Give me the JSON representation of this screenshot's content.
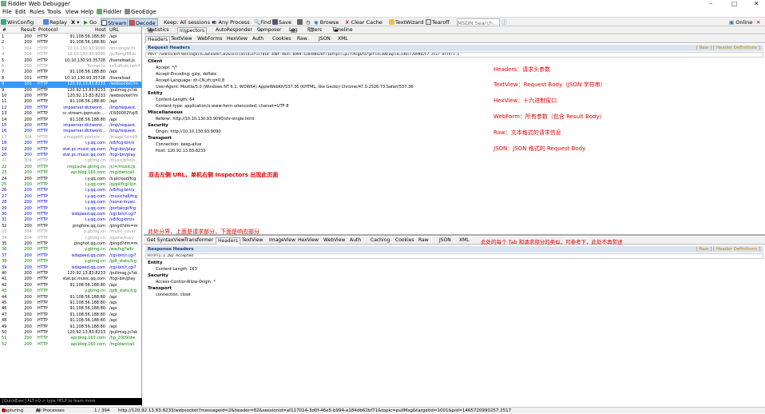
{
  "app": {
    "title": "Fiddler Web Debugger"
  },
  "menu": [
    "File",
    "Edit",
    "Rules",
    "Tools",
    "View",
    "Help",
    "Fiddler",
    "GeoEdge"
  ],
  "toolbar": {
    "winconfig": "WinConfig",
    "replay": "Replay",
    "x": "X",
    "go": "Go",
    "stream": "Stream",
    "decode": "Decode",
    "keep": "Keep: All sessions",
    "any_process": "Any Process",
    "find": "Find",
    "save": "Save",
    "browse": "Browse",
    "clear_cache": "Clear Cache",
    "textwizard": "TextWizard",
    "tearoff": "Tearoff",
    "msdn": "MSDN Search...",
    "online": "Online"
  },
  "sessions": {
    "columns": [
      "#",
      "Result",
      "Protocol",
      "Host",
      "URL"
    ],
    "rows": [
      [
        "1",
        "200",
        "HTTP",
        "91.108.56.188:80",
        "/api",
        "black"
      ],
      [
        "2",
        "200",
        "HTTP",
        "91.108.56.188:80",
        "/api",
        "black"
      ],
      [
        "3",
        "304",
        "HTTP",
        "10.10.130.93:9090",
        "/shr-single.ht",
        "gray"
      ],
      [
        "4",
        "304",
        "HTTP",
        "10.10.130.93:9090",
        "/js/RongIMLib",
        "gray"
      ],
      [
        "5",
        "200",
        "HTTP",
        "10.10.130.93:35728",
        "/livereload.js",
        "black"
      ],
      [
        "6",
        "200",
        "HTTP",
        "Tunnel to",
        "sv1.dfcdn.net:443",
        "gray"
      ],
      [
        "7",
        "200",
        "HTTP",
        "91.108.56.188:80",
        "/api",
        "black"
      ],
      [
        "8",
        "101",
        "HTTP",
        "10.10.130.93:35728",
        "/livereload",
        "black"
      ],
      [
        "9",
        "101",
        "HTTP",
        "120.92.13.83:8233",
        "/websocket?m",
        "sel"
      ],
      [
        "9",
        "200",
        "HTTP",
        "120.92.13.83:8233",
        "/pullmsg.js?sk",
        "black"
      ],
      [
        "10",
        "200",
        "HTTP",
        "120.92.13.83:8233",
        "/websocket?m",
        "black"
      ],
      [
        "11",
        "200",
        "HTTP",
        "91.108.56.188:80",
        "/api",
        "black"
      ],
      [
        "12",
        "200",
        "HTTP",
        "impserver.dictword...",
        "/imp/request.",
        "blue"
      ],
      [
        "13",
        "200",
        "HTTP",
        "cc.stream.qqmusic....",
        "/C600002Yzjl5",
        "black"
      ],
      [
        "14",
        "200",
        "HTTP",
        "91.108.56.188:80",
        "/api",
        "black"
      ],
      [
        "15",
        "200",
        "HTTP",
        "impserver.dictword...",
        "/imp/request.",
        "blue"
      ],
      [
        "16",
        "200",
        "HTTP",
        "impserver.dictword...",
        "/imp/request.",
        "blue"
      ],
      [
        "17",
        "304",
        "HTTP",
        "simageb5.ydstatic....",
        "/image?id=49",
        "gray"
      ],
      [
        "18",
        "200",
        "HTTP",
        "i.y.qq.com",
        "/v8/fcg-bin/v",
        "blue"
      ],
      [
        "19",
        "200",
        "HTTP",
        "stat.pc.music.qq.com",
        "/fcgi-bin/play",
        "blue"
      ],
      [
        "20",
        "200",
        "HTTP",
        "stat.pc.music.qq.com",
        "/fcgi-bin/play",
        "blue"
      ],
      [
        "21",
        "304",
        "HTTP",
        "i.gtimg.cn",
        "/music/photo_",
        "gray"
      ],
      [
        "22",
        "200",
        "HTTP",
        "imgcache.gtimg.cn",
        "/c/=/music/js",
        "green"
      ],
      [
        "23",
        "200",
        "HTTP",
        "api.blog.163.com",
        "/mg/dwr/call",
        "green"
      ],
      [
        "24",
        "200",
        "HTTP",
        "i.y.qq.com",
        "/s.plcloud/fcg",
        "black"
      ],
      [
        "25",
        "200",
        "HTTP",
        "i.y.qq.com",
        "/qzeli/fcgi-bin",
        "green"
      ],
      [
        "26",
        "200",
        "HTTP",
        "i.y.qq.com",
        "/v8/fcg-bin/v",
        "blue"
      ],
      [
        "27",
        "200",
        "HTTP",
        "i.y.qq.com",
        "/musichall/fcg",
        "blue"
      ],
      [
        "28",
        "200",
        "HTTP",
        "i.y.qq.com",
        "/rsone-music.",
        "blue"
      ],
      [
        "29",
        "200",
        "HTTP",
        "i.y.qq.com",
        "/portalcgi/fcg",
        "blue"
      ],
      [
        "30",
        "200",
        "HTTP",
        "isdspeed.qq.com",
        "/cgi-bin/r.cgi?",
        "blue"
      ],
      [
        "31",
        "200",
        "HTTP",
        "i.y.qq.com",
        "/v8/fcg-bin/v",
        "blue"
      ],
      [
        "32",
        "200",
        "HTTP",
        "pingfore.qq.com",
        "/pingd?dm=m",
        "black"
      ],
      [
        "33",
        "304",
        "HTTP",
        "p.gtimg.cn",
        "/music_cover",
        "gray"
      ],
      [
        "34",
        "304",
        "HTTP",
        "i.gtimg.cn",
        "/opone/icon/",
        "gray"
      ],
      [
        "35",
        "200",
        "HTTP",
        "pinghot.qq.com",
        "/pingd?dm=m",
        "black"
      ],
      [
        "36",
        "200",
        "HTTP",
        "y.gtimg.cn",
        "/ww.fcg?adc",
        "green"
      ],
      [
        "37",
        "200",
        "HTTP",
        "isdspeed.qq.com",
        "/cgi-bin/r.cgi?",
        "blue"
      ],
      [
        "38",
        "200",
        "HTTP",
        "y.gtimg.cn",
        "/gdt_stats.fcg",
        "green"
      ],
      [
        "39",
        "200",
        "HTTP",
        "isdspeed.qq.com",
        "/cgi-bin/r.cgi?",
        "blue"
      ],
      [
        "40",
        "200",
        "HTTP",
        "120.92.13.83:8233",
        "/pullmsg.js?sk",
        "black"
      ],
      [
        "41",
        "200",
        "HTTP",
        "stat.pc.music.qq.com",
        "/fcgi-bin/play",
        "black"
      ],
      [
        "42",
        "200",
        "HTTP",
        "91.108.56.188:80",
        "/api",
        "black"
      ],
      [
        "43",
        "200",
        "HTTP",
        "y.gtimg.cn",
        "/gdt_stats.fcg",
        "green"
      ],
      [
        "44",
        "200",
        "HTTP",
        "91.108.56.188:80",
        "/api",
        "black"
      ],
      [
        "45",
        "200",
        "HTTP",
        "91.108.56.188:80",
        "/api",
        "black"
      ],
      [
        "46",
        "200",
        "HTTP",
        "91.108.56.188:80",
        "/api",
        "black"
      ],
      [
        "47",
        "200",
        "HTTP",
        "91.108.56.188:80",
        "/api",
        "black"
      ],
      [
        "48",
        "200",
        "HTTP",
        "91.108.56.188:80",
        "/api",
        "black"
      ],
      [
        "49",
        "200",
        "HTTP",
        "91.108.56.188:80",
        "/api",
        "black"
      ],
      [
        "50",
        "200",
        "HTTP",
        "120.92.13.83:8233",
        "/pullmsg.js?sk",
        "black"
      ],
      [
        "51",
        "200",
        "HTTP",
        "api.blog.163.com",
        "/hp_2009/dw",
        "green"
      ],
      [
        "52",
        "200",
        "HTTP",
        "api.blog.163.com",
        "/mg/dwr/call",
        "green"
      ]
    ]
  },
  "quickexec": "[QuickExec] ALT+Q > type HELP to learn more",
  "status": {
    "capturing": "Capturing",
    "processes": "All Processes",
    "count": "1 / 394",
    "url": "http://120.92.13.83:8233/websocket?messageid=2&header=82&sessionid=af117014-3d0f-46e5-b994-a184db62bf71&topic=pullMsg&targetid=1001&pid=1465720990257.2517"
  },
  "inspector_tabs": [
    "Statistics",
    "Inspectors",
    "AutoResponder",
    "Composer",
    "Log",
    "Filters",
    "Timeline"
  ],
  "request_tabs": [
    "Headers",
    "TextView",
    "WebForms",
    "HexView",
    "Auth",
    "Cookies",
    "Raw",
    "JSON",
    "XML"
  ],
  "request": {
    "title": "Request Headers",
    "raw": "[ Raw ]   [ Header Definitions ]",
    "line": "POST /websocket?messageid=2&header=82&sessionid=af117014-3d0f-46e5-b994-a184db62bf71&topic=pullMsg&targetid=1001&pid=1465720990257.2517 HTTP/1.1",
    "groups": [
      {
        "name": "Client",
        "lines": [
          "Accept: */*",
          "Accept-Encoding: gzip, deflate",
          "Accept-Language: zh-CN,zh;q=0.8",
          "User-Agent: Mozilla/5.0 (Windows NT 6.1; WOW64) AppleWebKit/537.36 (KHTML, like Gecko) Chrome/47.0.2526.73 Safari/537.36"
        ]
      },
      {
        "name": "Entity",
        "lines": [
          "Content-Length: 64",
          "Content-type: application/x-www-form-urlencoded; charset=UTF-8"
        ]
      },
      {
        "name": "Miscellaneous",
        "lines": [
          "Referer: http://10.10.130.93:9090/shr-single.html"
        ]
      },
      {
        "name": "Security",
        "lines": [
          "Origin: http://10.10.130.93:9090"
        ]
      },
      {
        "name": "Transport",
        "lines": [
          "Connection: keep-alive",
          "Host: 120.92.13.83:8233"
        ]
      }
    ]
  },
  "notes": {
    "headers": "Headers：请求头参数",
    "textview": "TextView：Request Body（JSON 字符串）",
    "hexview": "HexView：十六进制窗口",
    "webform": "WebForm：所有参数（包含 Result Body）",
    "raw": "Raw：文本格式的请求信息",
    "json": "JSON：JSON 格式的 Request Body",
    "dblclick": "双击左侧 URL，单机右侧 Inspectors 出现此页面",
    "split": "此处分界，上面是请求部分，下面是响应部分",
    "tabs": "此处的每个 Tab 和请求部分的类似，可参考下，此处不再赘述"
  },
  "response_tabs": [
    "Get SyntaxView",
    "Transformer",
    "Headers",
    "TextView",
    "ImageView",
    "HexView",
    "WebView",
    "Auth",
    "Caching",
    "Cookies",
    "Raw",
    "JSON",
    "XML"
  ],
  "response": {
    "title": "Response Headers",
    "raw": "[ Raw ]   [ Header Definitions ]",
    "line": "HTTP/1.1 202 Accepted",
    "groups": [
      {
        "name": "Entity",
        "lines": [
          "Content-Length: 163"
        ]
      },
      {
        "name": "Security",
        "lines": [
          "Access-Control-Allow-Origin: *"
        ]
      },
      {
        "name": "Transport",
        "lines": [
          "connection: close"
        ]
      }
    ]
  }
}
